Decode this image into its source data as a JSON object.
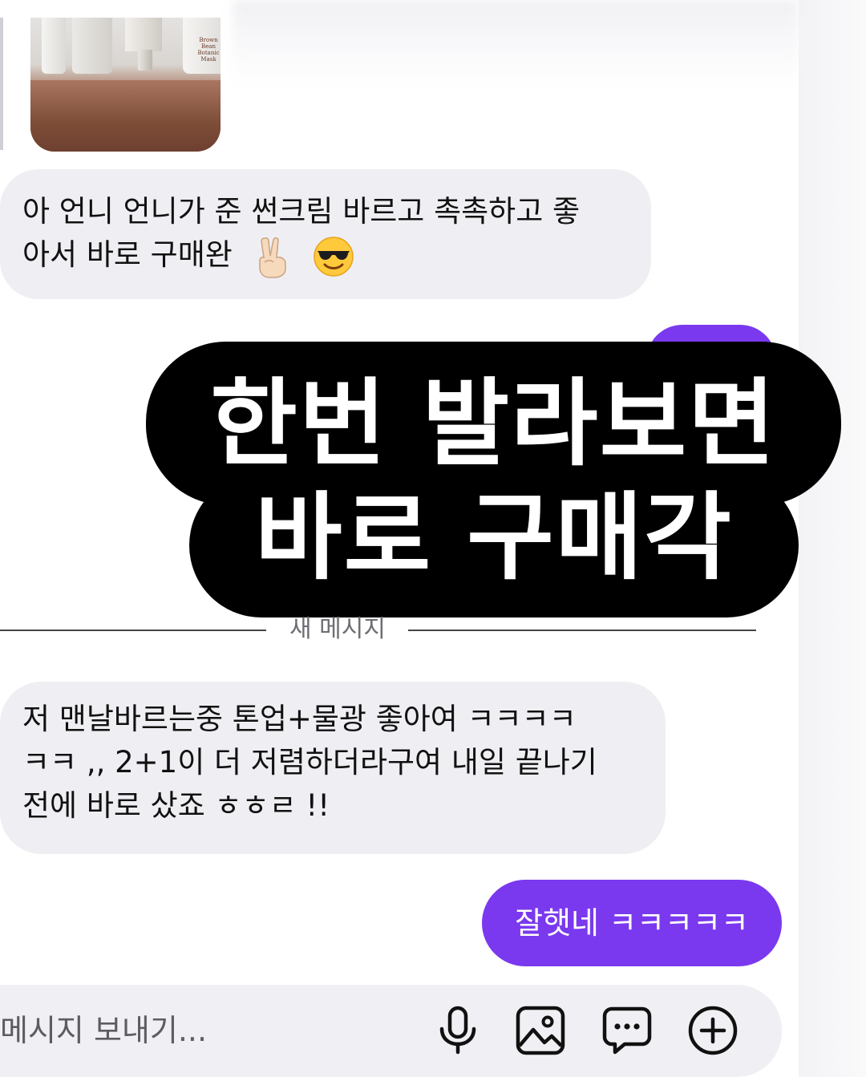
{
  "photo": {
    "label_text": "Brown\nBean\nBotanic\nMask"
  },
  "messages": [
    {
      "direction": "incoming",
      "lines": [
        "아 언니 언니가 준 썬크림 바르고 촉촉하고 좋",
        "아서 바로 구매완"
      ],
      "emojis": [
        "victory-hand",
        "smiling-face-with-sunglasses"
      ]
    },
    {
      "direction": "incoming",
      "lines": [
        "저 맨날바르는중 톤업+물광 좋아여 ㅋㅋㅋㅋ",
        "ㅋㅋ ,, 2+1이 더 저렴하더라구여 내일 끝나기",
        "전에 바로 샀죠 ㅎㅎㄹ !!"
      ]
    },
    {
      "direction": "outgoing",
      "text": "잘햇네 ㅋㅋㅋㅋㅋ"
    }
  ],
  "overlay_caption": {
    "line1": "한번 발라보면",
    "line2": "바로 구매각"
  },
  "divider": {
    "label": "새 메시지"
  },
  "composer": {
    "placeholder": "메시지 보내기...",
    "icons": [
      "microphone-icon",
      "image-icon",
      "chat-bubble-icon",
      "plus-circle-icon"
    ]
  },
  "colors": {
    "outgoing_bubble": "#7a39ee",
    "incoming_bubble": "#efeff3",
    "caption_background": "#000000"
  }
}
